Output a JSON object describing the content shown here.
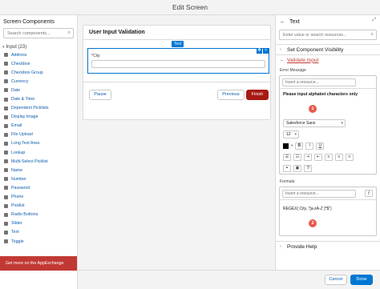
{
  "window": {
    "title": "Edit Screen"
  },
  "left_panel": {
    "title": "Screen Components",
    "search_placeholder": "Search components...",
    "section": "Input (23)",
    "items": [
      "Address",
      "Checkbox",
      "Checkbox Group",
      "Currency",
      "Date",
      "Date & Time",
      "Dependent Picklists",
      "Display Image",
      "Email",
      "File Upload",
      "Long Text Area",
      "Lookup",
      "Multi-Select Picklist",
      "Name",
      "Number",
      "Password",
      "Phone",
      "Picklist",
      "Radio Buttons",
      "Slider",
      "Text",
      "Toggle"
    ],
    "appexchange": "Get more on the AppExchange"
  },
  "canvas": {
    "screen_title": "User Input Validation",
    "component_tag": "Text",
    "field_label": "City",
    "buttons": {
      "pause": "Pause",
      "previous": "Previous",
      "finish": "Finish"
    }
  },
  "right_panel": {
    "header": "Text",
    "search_placeholder": "Enter value or search resources...",
    "sections": {
      "visibility": "Set Component Visibility",
      "validate": "Validate Input",
      "provide_help": "Provide Help"
    },
    "error_message_label": "Error Message",
    "insert_placeholder": "Insert a resource...",
    "error_message_text": "Please input alphabet characters only",
    "font_family": "Salesforce Sans",
    "font_size": "12",
    "formula_label": "Formula",
    "formula_text": "REGEX( City, \"[a-zA-Z ]*$\")",
    "badges": [
      "1",
      "2"
    ],
    "toolbar": [
      "B",
      "I",
      "U"
    ],
    "align": [
      "≡",
      "≡",
      "≡",
      "≡"
    ]
  },
  "footer": {
    "cancel": "Cancel",
    "done": "Done"
  },
  "colors": {
    "brand": "#0176d3",
    "finish": "#a61a14",
    "appexchange": "#c23934",
    "badge": "#e8594b"
  }
}
